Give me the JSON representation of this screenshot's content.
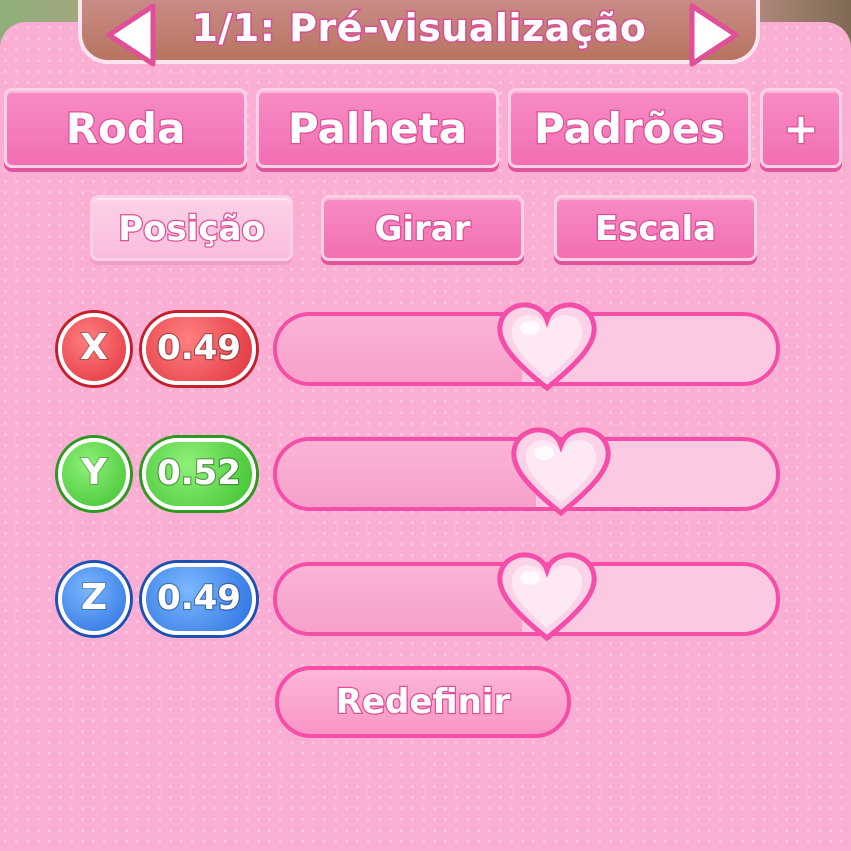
{
  "header": {
    "title": "1/1: Pré-visualização"
  },
  "tabs": [
    {
      "label": "Roda"
    },
    {
      "label": "Palheta"
    },
    {
      "label": "Padrões"
    },
    {
      "label": "+"
    }
  ],
  "subtabs": [
    {
      "label": "Posição",
      "active": true
    },
    {
      "label": "Girar",
      "active": false
    },
    {
      "label": "Escala",
      "active": false
    }
  ],
  "sliders": [
    {
      "axis": "X",
      "value": "0.49",
      "level": 0.49,
      "color": "#e0323c"
    },
    {
      "axis": "Y",
      "value": "0.52",
      "level": 0.52,
      "color": "#3fc12e"
    },
    {
      "axis": "Z",
      "value": "0.49",
      "level": 0.49,
      "color": "#2a6fe0"
    }
  ],
  "reset_label": "Redefinir",
  "colors": {
    "accent": "#f44ea8",
    "panel": "#fbaed3",
    "button": "#f26fb2"
  },
  "icons": {
    "prev": "chevron-left-icon",
    "next": "chevron-right-icon",
    "knob": "heart-icon"
  }
}
